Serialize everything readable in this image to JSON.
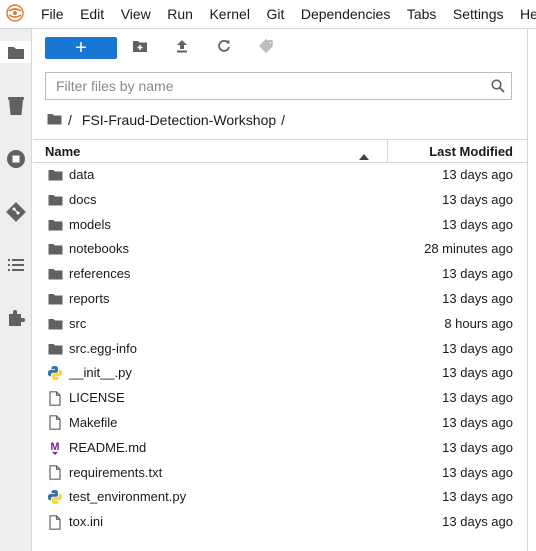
{
  "menubar": {
    "items": [
      "File",
      "Edit",
      "View",
      "Run",
      "Kernel",
      "Git",
      "Dependencies",
      "Tabs",
      "Settings",
      "He"
    ]
  },
  "toolbar": {
    "new_label": "+",
    "icons": [
      "new-folder-icon",
      "upload-icon",
      "refresh-icon",
      "git-clone-icon"
    ]
  },
  "search": {
    "placeholder": "Filter files by name",
    "value": ""
  },
  "breadcrumb": {
    "root": "/",
    "folder": "FSI-Fraud-Detection-Workshop",
    "trailing": "/"
  },
  "columns": {
    "name": "Name",
    "modified": "Last Modified"
  },
  "files": [
    {
      "name": "data",
      "modified": "13 days ago",
      "type": "folder"
    },
    {
      "name": "docs",
      "modified": "13 days ago",
      "type": "folder"
    },
    {
      "name": "models",
      "modified": "13 days ago",
      "type": "folder"
    },
    {
      "name": "notebooks",
      "modified": "28 minutes ago",
      "type": "folder"
    },
    {
      "name": "references",
      "modified": "13 days ago",
      "type": "folder"
    },
    {
      "name": "reports",
      "modified": "13 days ago",
      "type": "folder"
    },
    {
      "name": "src",
      "modified": "8 hours ago",
      "type": "folder"
    },
    {
      "name": "src.egg-info",
      "modified": "13 days ago",
      "type": "folder"
    },
    {
      "name": "__init__.py",
      "modified": "13 days ago",
      "type": "python"
    },
    {
      "name": "LICENSE",
      "modified": "13 days ago",
      "type": "file"
    },
    {
      "name": "Makefile",
      "modified": "13 days ago",
      "type": "file"
    },
    {
      "name": "README.md",
      "modified": "13 days ago",
      "type": "markdown"
    },
    {
      "name": "requirements.txt",
      "modified": "13 days ago",
      "type": "file"
    },
    {
      "name": "test_environment.py",
      "modified": "13 days ago",
      "type": "python"
    },
    {
      "name": "tox.ini",
      "modified": "13 days ago",
      "type": "file"
    }
  ],
  "colors": {
    "accent": "#1976d2",
    "markdown": "#7b1fa2",
    "python_blue": "#3572a5",
    "python_yellow": "#ffd43b"
  },
  "activity_icons": [
    "folder-icon",
    "running-icon",
    "stop-icon",
    "git-icon",
    "toc-icon",
    "extension-icon"
  ]
}
